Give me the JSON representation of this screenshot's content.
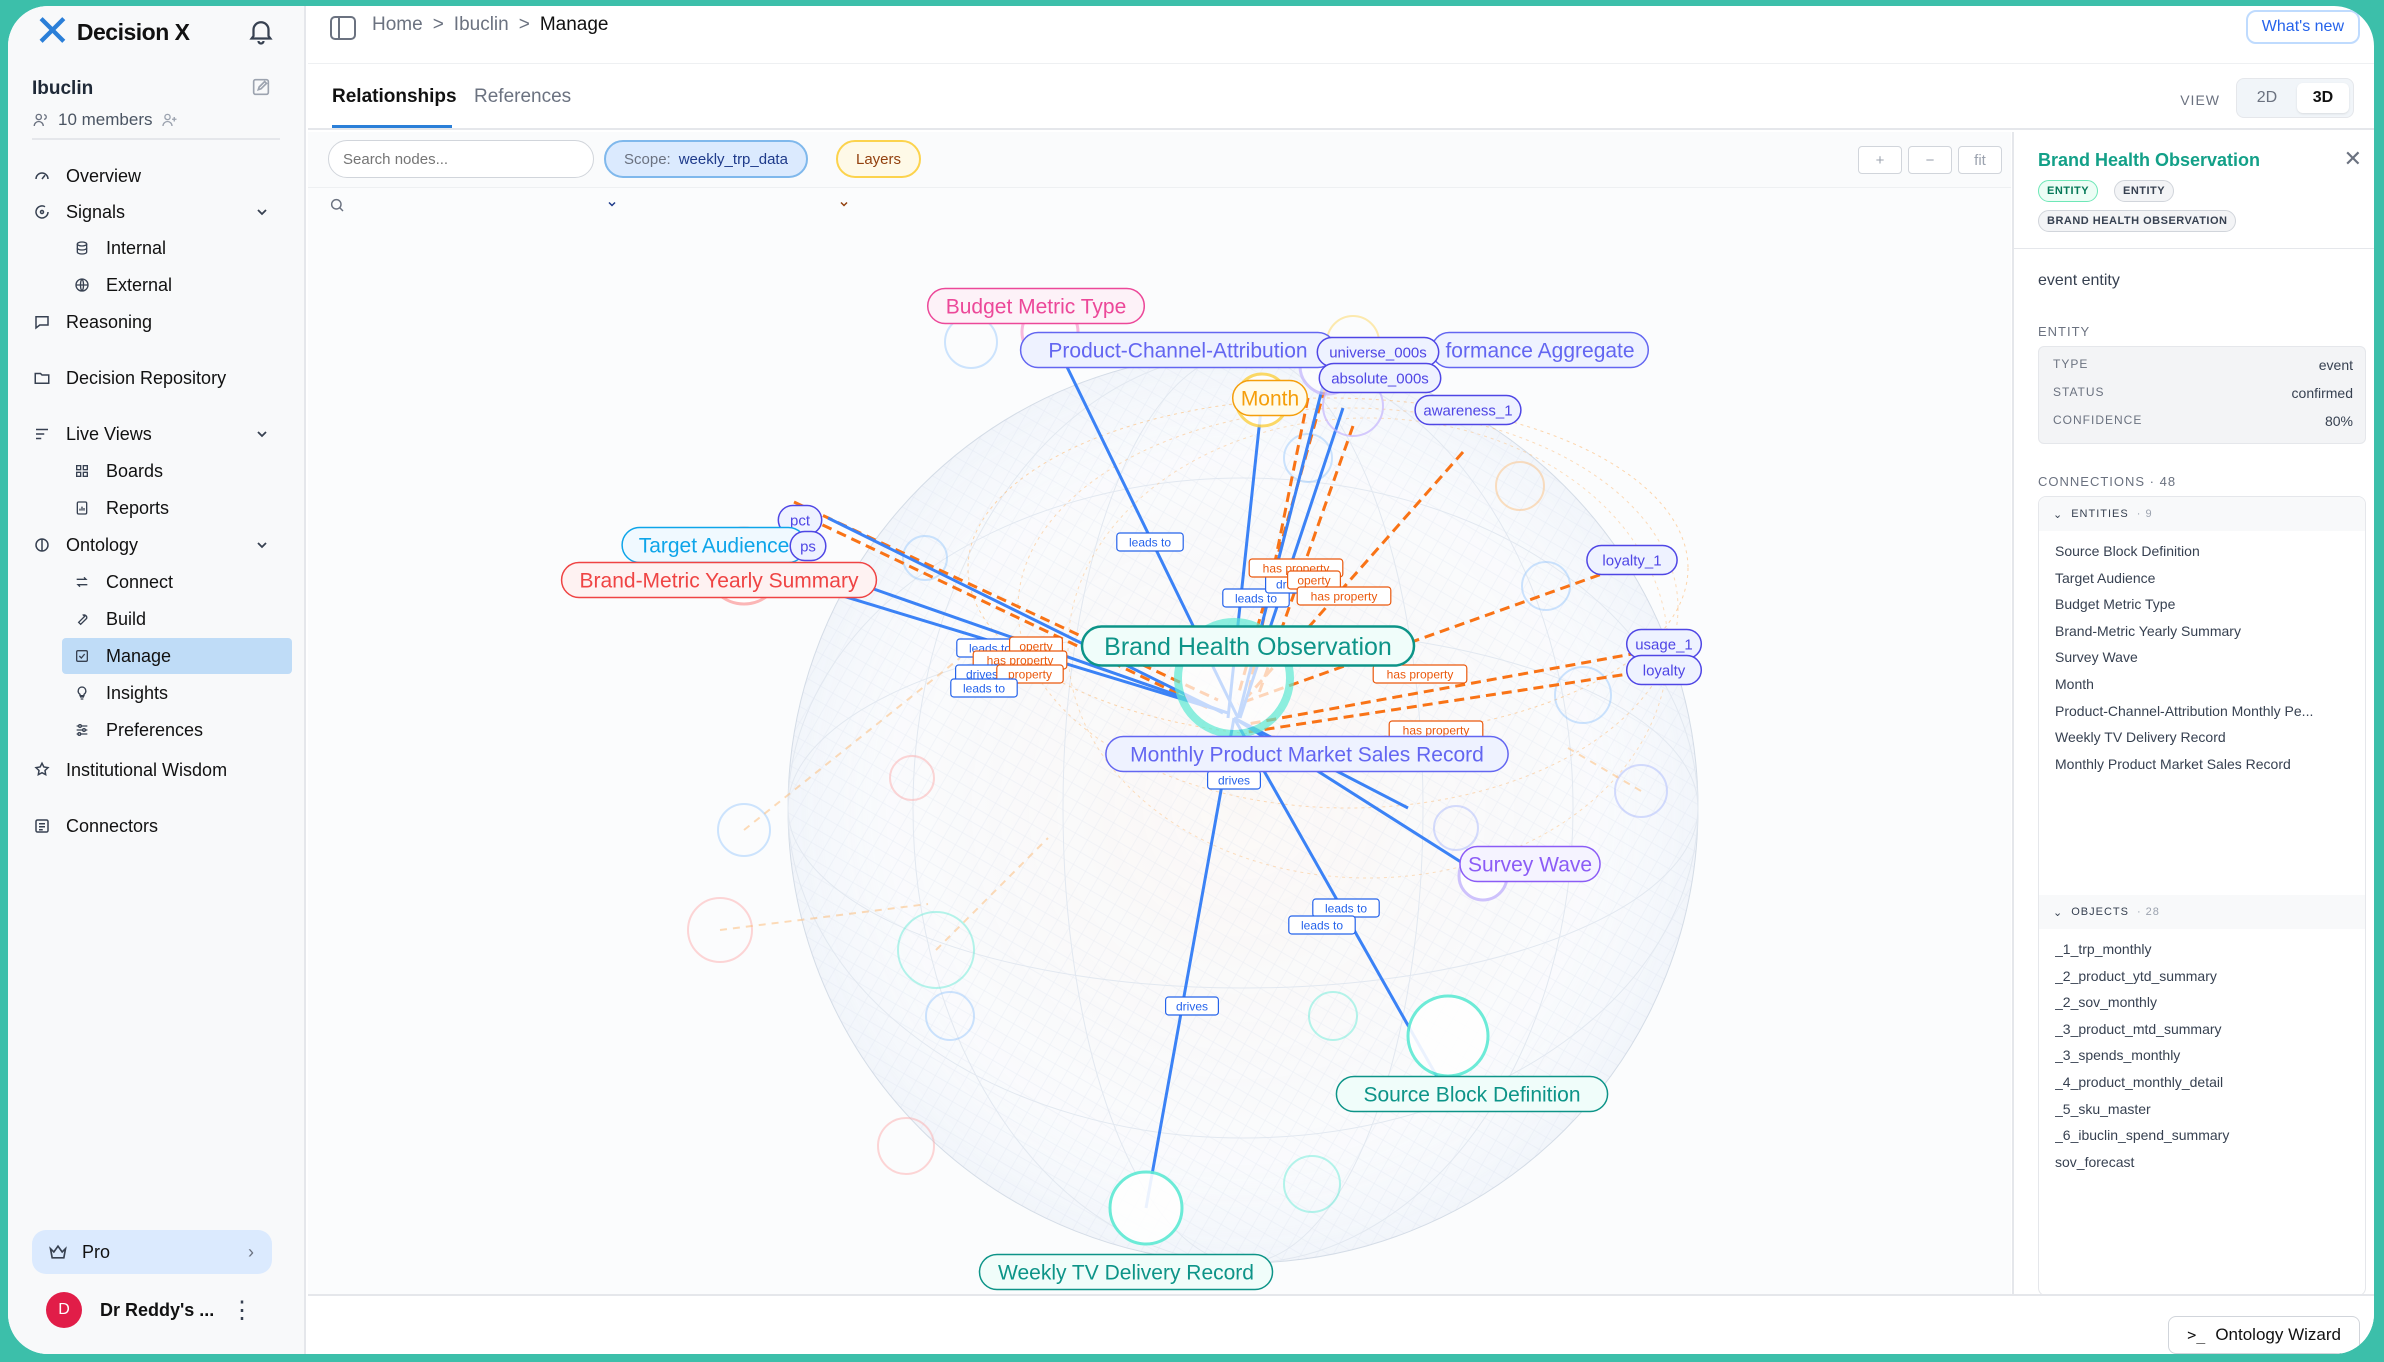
{
  "brand": {
    "name": "Decision X"
  },
  "workspace": {
    "name": "Ibuclin",
    "members": "10 members"
  },
  "nav": {
    "overview": "Overview",
    "signals": "Signals",
    "internal": "Internal",
    "external": "External",
    "reasoning": "Reasoning",
    "decision_repository": "Decision Repository",
    "live_views": "Live Views",
    "boards": "Boards",
    "reports": "Reports",
    "ontology": "Ontology",
    "connect": "Connect",
    "build": "Build",
    "manage": "Manage",
    "insights": "Insights",
    "preferences": "Preferences",
    "institutional_wisdom": "Institutional Wisdom",
    "connectors": "Connectors"
  },
  "plan": {
    "label": "Pro"
  },
  "user": {
    "name": "Dr Reddy's ...",
    "initial": "D"
  },
  "breadcrumb": {
    "home": "Home",
    "workspace": "Ibuclin",
    "current": "Manage",
    "sep": ">"
  },
  "whats_new": "What's new",
  "tabs": {
    "relationships": "Relationships",
    "references": "References"
  },
  "view": {
    "label": "VIEW",
    "opt_2d": "2D",
    "opt_3d": "3D",
    "selected": "3D"
  },
  "toolbar": {
    "search_placeholder": "Search nodes...",
    "scope_label": "Scope:",
    "scope_value": "weekly_trp_data",
    "layers": "Layers",
    "zoom_in": "+",
    "zoom_out": "−",
    "fit": "fit"
  },
  "graph": {
    "nodes": {
      "budget": "Budget Metric Type",
      "pca": "Product-Channel-Attribution",
      "perf": "formance Aggregate",
      "universe": "universe_000s",
      "absolute": "absolute_000s",
      "month": "Month",
      "awareness": "awareness_1",
      "pct": "pct",
      "target": "Target Audience",
      "brandmetric": "Brand-Metric Yearly Summary",
      "ps": "ps",
      "loyalty1": "loyalty_1",
      "usage": "usage_1",
      "loyalty": "loyalty",
      "bho": "Brand Health Observation",
      "mpms": "Monthly Product Market Sales Record",
      "survey": "Survey Wave",
      "source": "Source Block Definition",
      "wtv": "Weekly TV Delivery Record"
    },
    "edge_labels": {
      "leads_to": "leads to",
      "drives": "drives",
      "has_property": "has property",
      "property": "property",
      "operty": "operty"
    }
  },
  "wizard": "Ontology Wizard",
  "details": {
    "title": "Brand Health Observation",
    "badges": [
      "ENTITY",
      "ENTITY",
      "BRAND HEALTH OBSERVATION"
    ],
    "description": "event entity",
    "entity_section": "ENTITY",
    "props": [
      {
        "k": "TYPE",
        "v": "event"
      },
      {
        "k": "STATUS",
        "v": "confirmed"
      },
      {
        "k": "CONFIDENCE",
        "v": "80%"
      }
    ],
    "connections_label": "CONNECTIONS · 48",
    "entities_group": "ENTITIES",
    "entities_count": "· 9",
    "entities": [
      "Source Block Definition",
      "Target Audience",
      "Budget Metric Type",
      "Brand-Metric Yearly Summary",
      "Survey Wave",
      "Month",
      "Product-Channel-Attribution Monthly Pe...",
      "Weekly TV Delivery Record",
      "Monthly Product Market Sales Record"
    ],
    "objects_group": "OBJECTS",
    "objects_count": "· 28",
    "objects": [
      "_1_trp_monthly",
      "_2_product_ytd_summary",
      "_2_sov_monthly",
      "_3_product_mtd_summary",
      "_3_spends_monthly",
      "_4_product_monthly_detail",
      "_5_sku_master",
      "_6_ibuclin_spend_summary",
      "sov_forecast"
    ]
  },
  "colors": {
    "accent": "#2b7fd8",
    "teal": "#13a088",
    "edge_blue": "#3b82f6",
    "edge_orange": "#f97316",
    "frame": "#3cbfaa"
  }
}
